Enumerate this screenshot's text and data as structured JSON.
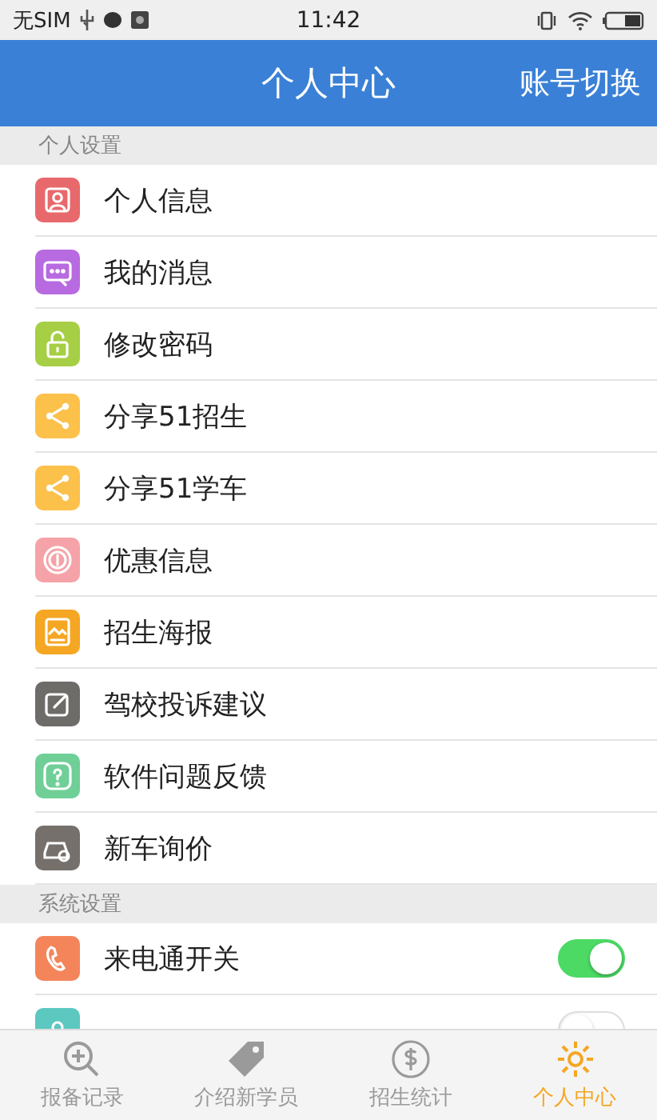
{
  "status_bar": {
    "carrier": "无SIM",
    "time": "11:42"
  },
  "header": {
    "title": "个人中心",
    "action": "账号切换"
  },
  "sections": [
    {
      "title": "个人设置",
      "items": [
        {
          "kind": "link",
          "label": "个人信息",
          "color": "#e8696b"
        },
        {
          "kind": "link",
          "label": "我的消息",
          "color": "#b86ae0"
        },
        {
          "kind": "link",
          "label": "修改密码",
          "color": "#a6cf45"
        },
        {
          "kind": "link",
          "label": "分享51招生",
          "color": "#fbc14a"
        },
        {
          "kind": "link",
          "label": "分享51学车",
          "color": "#fbc14b"
        },
        {
          "kind": "link",
          "label": "优惠信息",
          "color": "#f5a3a8"
        },
        {
          "kind": "link",
          "label": "招生海报",
          "color": "#f5a623"
        },
        {
          "kind": "link",
          "label": "驾校投诉建议",
          "color": "#6d6c68"
        },
        {
          "kind": "link",
          "label": "软件问题反馈",
          "color": "#6fcf97"
        },
        {
          "kind": "link",
          "label": "新车询价",
          "color": "#76706c"
        }
      ]
    },
    {
      "title": "系统设置",
      "items": [
        {
          "kind": "toggle",
          "label": "来电通开关",
          "color": "#f4845a",
          "on": true
        },
        {
          "kind": "toggle",
          "color": "#5cc8c0",
          "on": false
        }
      ]
    }
  ],
  "tabs": [
    {
      "label": "报备记录",
      "selected": false
    },
    {
      "label": "介绍新学员",
      "selected": false
    },
    {
      "label": "招生统计",
      "selected": false
    },
    {
      "label": "个人中心",
      "selected": true
    }
  ]
}
